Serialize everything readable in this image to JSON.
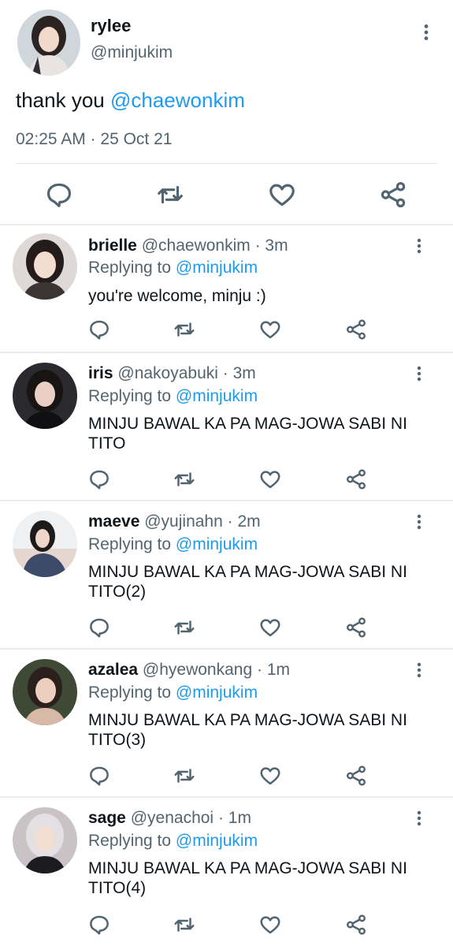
{
  "main_tweet": {
    "name": "rylee",
    "handle": "@minjukim",
    "text_prefix": "thank you ",
    "mention": "@chaewonkim",
    "timestamp": "02:25 AM · 25 Oct 21",
    "actions": [
      "reply-icon",
      "retweet-icon",
      "like-icon",
      "share-icon"
    ]
  },
  "replying_label": "Replying to",
  "replies": [
    {
      "name": "brielle",
      "handle": "@chaewonkim",
      "time": "· 3m",
      "replying_to": "@minjukim",
      "text": "you're welcome, minju :)"
    },
    {
      "name": "iris",
      "handle": "@nakoyabuki",
      "time": "· 3m",
      "replying_to": "@minjukim",
      "text": "MINJU BAWAL KA PA MAG-JOWA SABI NI TITO"
    },
    {
      "name": "maeve",
      "handle": "@yujinahn",
      "time": "· 2m",
      "replying_to": "@minjukim",
      "text": "MINJU BAWAL KA PA MAG-JOWA SABI NI TITO(2)"
    },
    {
      "name": "azalea",
      "handle": "@hyewonkang",
      "time": "· 1m",
      "replying_to": "@minjukim",
      "text": "MINJU BAWAL KA PA MAG-JOWA SABI NI TITO(3)"
    },
    {
      "name": "sage",
      "handle": "@yenachoi",
      "time": "· 1m",
      "replying_to": "@minjukim",
      "text": "MINJU BAWAL KA PA MAG-JOWA SABI NI TITO(4)"
    }
  ],
  "colors": {
    "accent": "#1d9bf0",
    "secondary_text": "#536471",
    "divider": "#e8ecef"
  }
}
